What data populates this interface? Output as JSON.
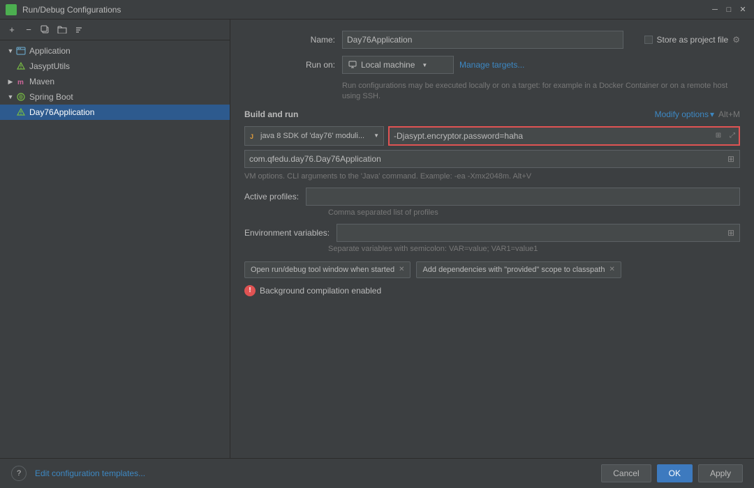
{
  "window": {
    "title": "Run/Debug Configurations",
    "close_label": "✕",
    "minimize_label": "─",
    "maximize_label": "□"
  },
  "toolbar": {
    "add_label": "+",
    "remove_label": "−",
    "copy_label": "⎘",
    "folder_label": "📁",
    "sort_label": "↕"
  },
  "sidebar": {
    "items": [
      {
        "type": "group",
        "label": "Application",
        "expanded": true,
        "level": 0,
        "children": [
          {
            "label": "JasyptUtils",
            "level": 1
          }
        ]
      },
      {
        "type": "group",
        "label": "Maven",
        "expanded": false,
        "level": 0,
        "children": []
      },
      {
        "type": "group",
        "label": "Spring Boot",
        "expanded": true,
        "level": 0,
        "children": [
          {
            "label": "Day76Application",
            "level": 1,
            "selected": true
          }
        ]
      }
    ],
    "edit_templates_label": "Edit configuration templates..."
  },
  "config": {
    "name_label": "Name:",
    "name_value": "Day76Application",
    "run_on_label": "Run on:",
    "local_machine_label": "Local machine",
    "manage_targets_label": "Manage targets...",
    "hint_text": "Run configurations may be executed locally or on a target: for example in a Docker Container or on a remote host using SSH.",
    "build_run_label": "Build and run",
    "modify_options_label": "Modify options",
    "modify_options_shortcut": "Alt+M",
    "sdk_label": "java 8 SDK of 'day76' moduli...",
    "vm_options_value": "-Djasypt.encryptor.password=haha",
    "main_class_value": "com.qfedu.day76.Day76Application",
    "vm_hint": "VM options. CLI arguments to the 'Java' command. Example: -ea -Xmx2048m. Alt+V",
    "active_profiles_label": "Active profiles:",
    "profiles_hint": "Comma separated list of profiles",
    "env_vars_label": "Environment variables:",
    "env_hint": "Separate variables with semicolon: VAR=value; VAR1=value1",
    "tag1_label": "Open run/debug tool window when started",
    "tag2_label": "Add dependencies with \"provided\" scope to classpath",
    "warning_text": "Background compilation enabled",
    "store_label": "Store as project file",
    "ok_label": "OK",
    "cancel_label": "Cancel",
    "apply_label": "Apply",
    "help_label": "?"
  }
}
